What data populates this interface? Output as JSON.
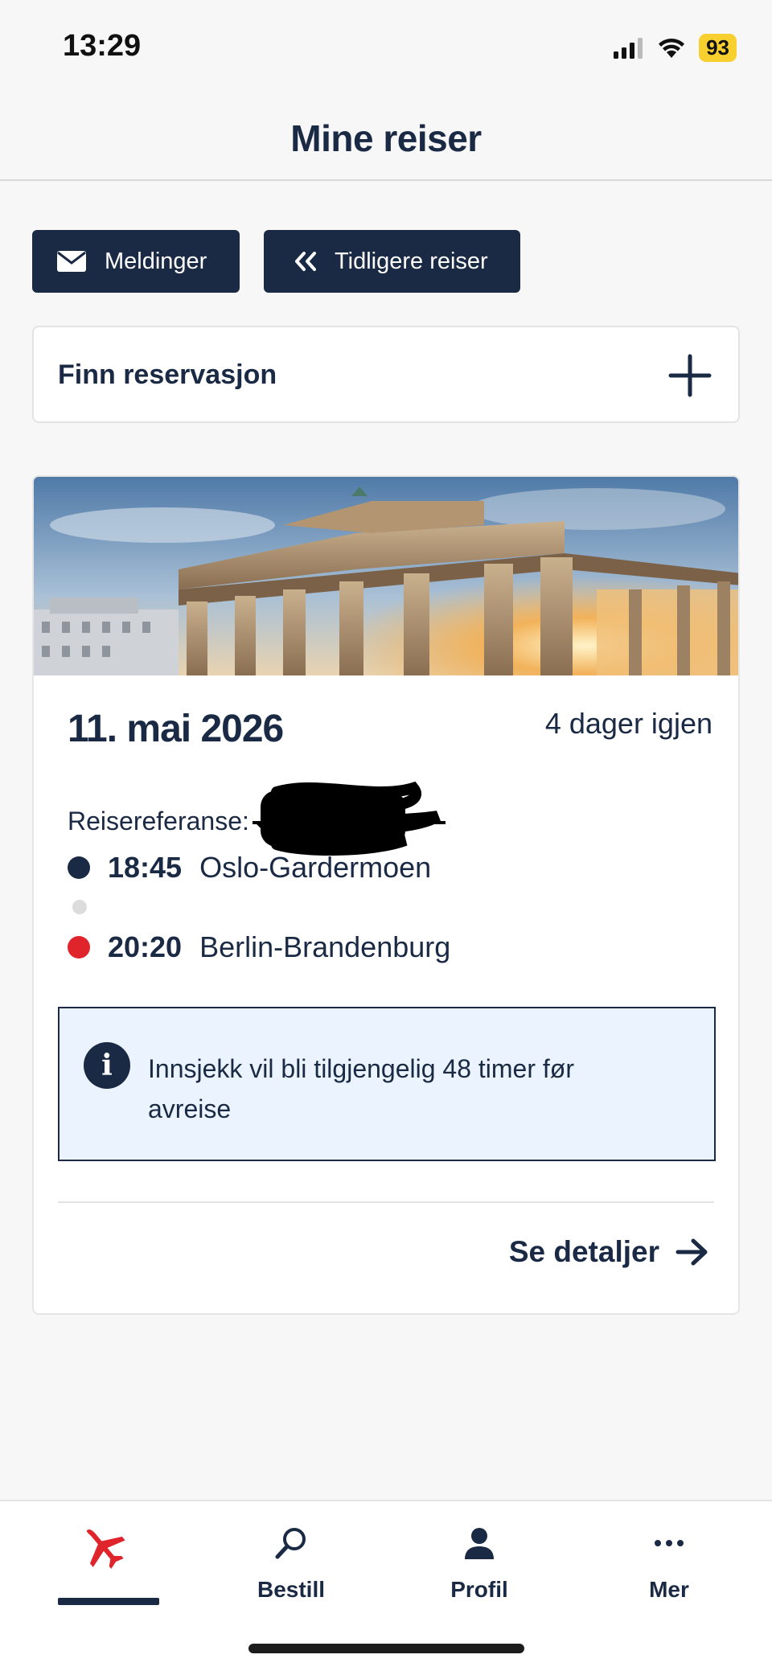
{
  "status": {
    "time": "13:29",
    "battery": "93"
  },
  "header": {
    "title": "Mine reiser"
  },
  "actions": {
    "messages_label": "Meldinger",
    "previous_label": "Tidligere reiser"
  },
  "find_reservation": {
    "label": "Finn reservasjon"
  },
  "trip": {
    "date": "11. mai 2026",
    "countdown": "4 dager igjen",
    "reference_label": "Reisereferanse:",
    "departure": {
      "time": "18:45",
      "airport": "Oslo-Gardermoen"
    },
    "arrival": {
      "time": "20:20",
      "airport": "Berlin-Brandenburg"
    },
    "notice": "Innsjekk vil bli tilgjengelig 48 timer før avreise",
    "details_label": "Se detaljer"
  },
  "tabs": [
    {
      "label": "",
      "icon": "plane-icon",
      "active": true
    },
    {
      "label": "Bestill",
      "icon": "search-icon"
    },
    {
      "label": "Profil",
      "icon": "person-icon"
    },
    {
      "label": "Mer",
      "icon": "more-icon"
    }
  ],
  "colors": {
    "navy": "#1b2a44",
    "red": "#e0242b",
    "info_bg": "#eaf3fe",
    "battery": "#f7cf2f"
  }
}
